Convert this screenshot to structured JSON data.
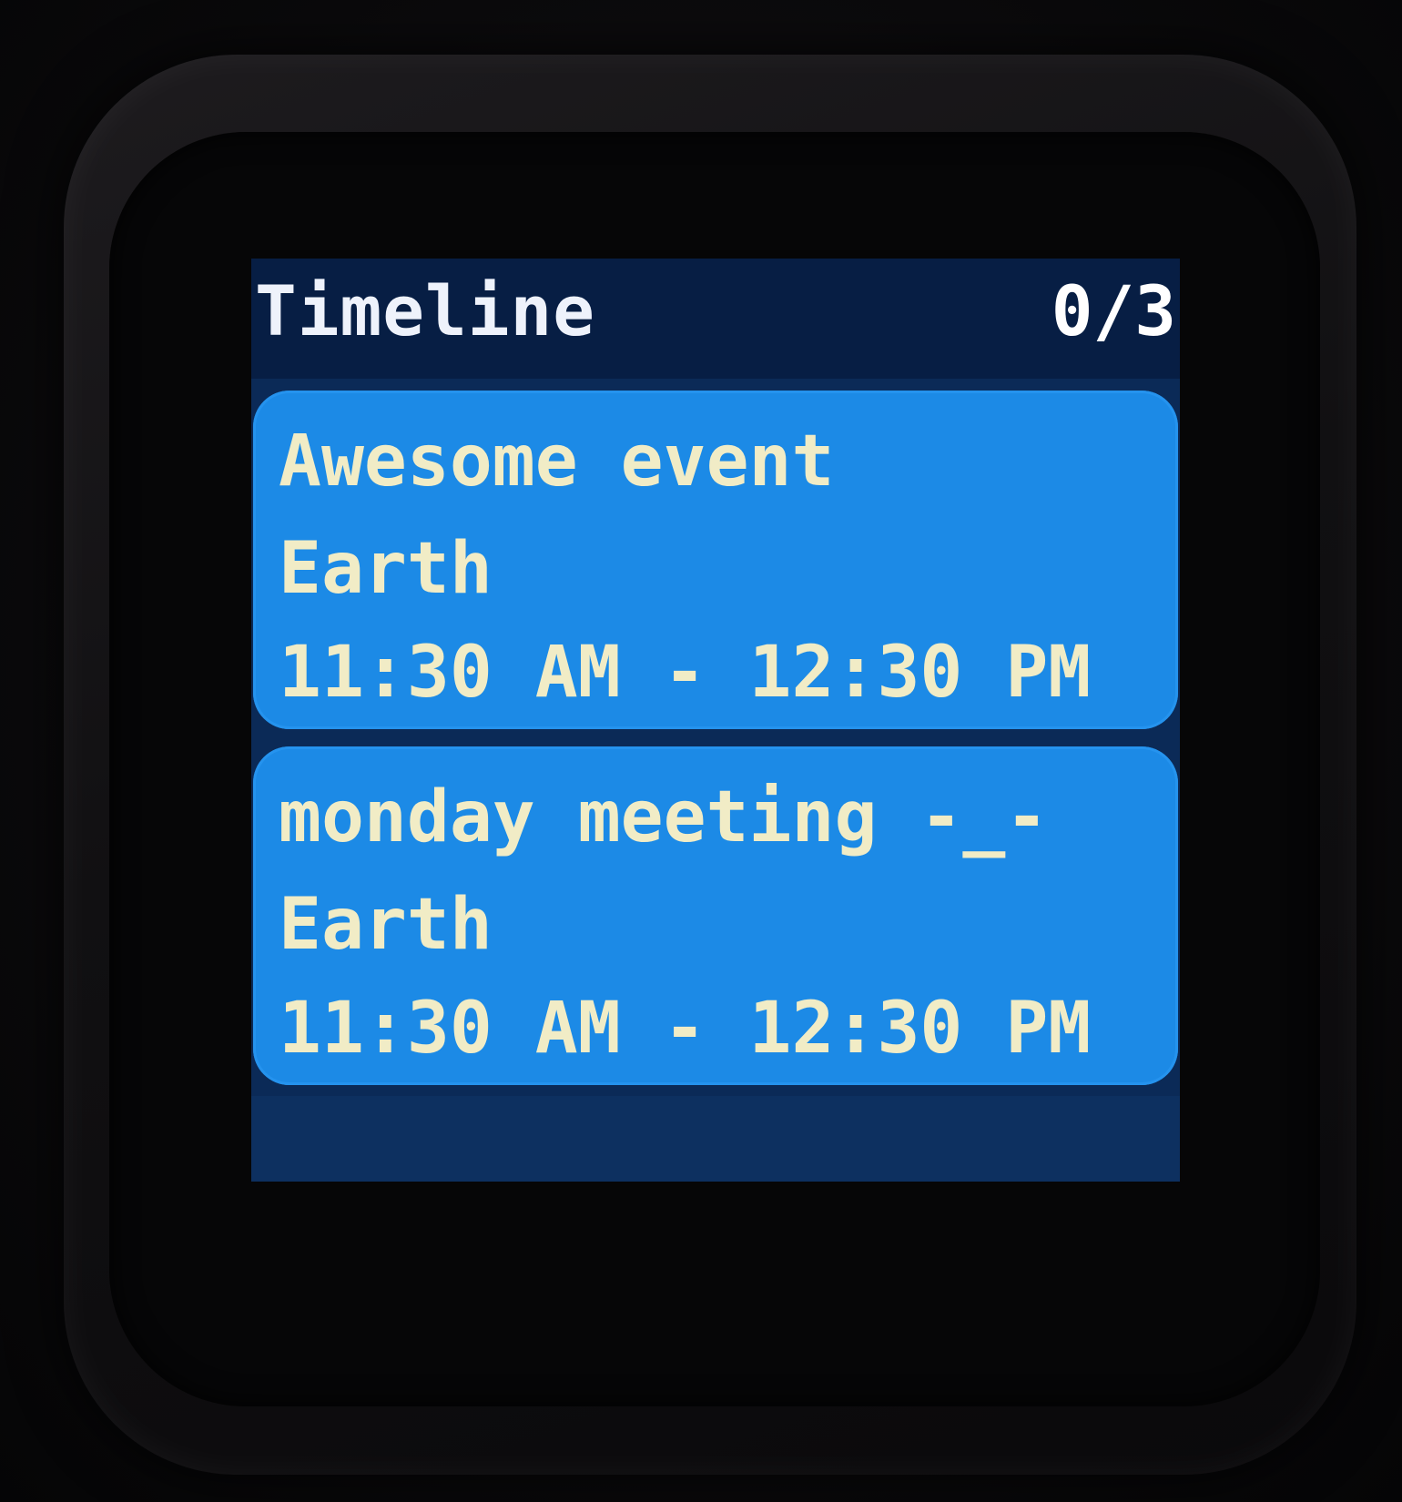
{
  "app": {
    "title": "Timeline",
    "counter": "0/3"
  },
  "events": [
    {
      "title": "Awesome event",
      "location": "Earth",
      "time": "11:30 AM - 12:30 PM"
    },
    {
      "title": "monday meeting -_-",
      "location": "Earth",
      "time": "11:30 AM - 12:30 PM"
    }
  ],
  "colors": {
    "header_bg": "#071e44",
    "screen_bg": "#0b2a57",
    "card_bg": "#1c8ae6",
    "card_text": "#f1ecc6",
    "header_text": "#eef2fb"
  }
}
